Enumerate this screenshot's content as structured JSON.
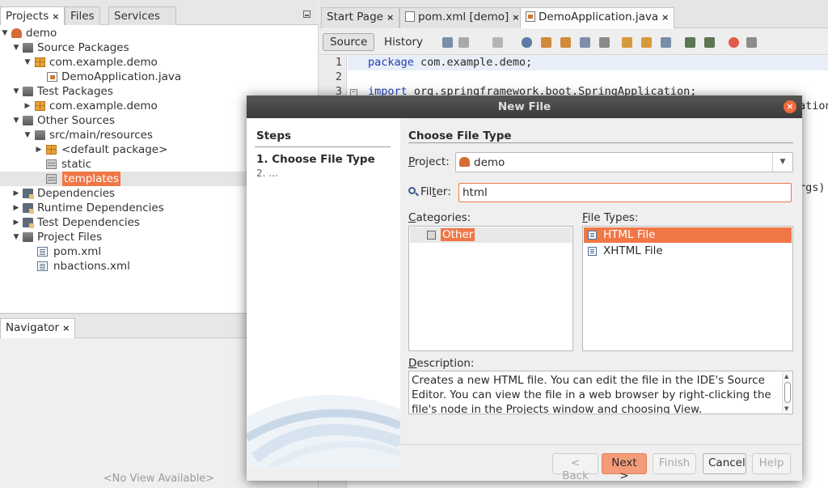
{
  "projects_panel": {
    "tabs": [
      {
        "label": "Projects",
        "active": true,
        "closable": true
      },
      {
        "label": "Files",
        "active": false,
        "closable": false
      },
      {
        "label": "Services",
        "active": false,
        "closable": false
      }
    ],
    "tree": [
      {
        "label": "demo",
        "icon": "project-icon",
        "toggle": "expanded"
      },
      {
        "label": "Source Packages",
        "icon": "source-packages-icon",
        "toggle": "expanded"
      },
      {
        "label": "com.example.demo",
        "icon": "package-icon",
        "toggle": "expanded"
      },
      {
        "label": "DemoApplication.java",
        "icon": "java-file-icon",
        "toggle": "none"
      },
      {
        "label": "Test Packages",
        "icon": "test-packages-icon",
        "toggle": "expanded"
      },
      {
        "label": "com.example.demo",
        "icon": "package-icon",
        "toggle": "collapsed"
      },
      {
        "label": "Other Sources",
        "icon": "other-sources-icon",
        "toggle": "expanded"
      },
      {
        "label": "src/main/resources",
        "icon": "resources-icon",
        "toggle": "expanded"
      },
      {
        "label": "<default package>",
        "icon": "package-icon",
        "toggle": "collapsed"
      },
      {
        "label": "static",
        "icon": "folder-icon",
        "toggle": "none"
      },
      {
        "label": "templates",
        "icon": "folder-icon",
        "toggle": "none",
        "selected": true
      },
      {
        "label": "Dependencies",
        "icon": "dependencies-icon",
        "toggle": "collapsed"
      },
      {
        "label": "Runtime Dependencies",
        "icon": "dependencies-icon",
        "toggle": "collapsed"
      },
      {
        "label": "Test Dependencies",
        "icon": "dependencies-icon",
        "toggle": "collapsed"
      },
      {
        "label": "Project Files",
        "icon": "project-files-icon",
        "toggle": "expanded"
      },
      {
        "label": "pom.xml",
        "icon": "xml-file-icon",
        "toggle": "none"
      },
      {
        "label": "nbactions.xml",
        "icon": "xml-file-icon",
        "toggle": "none"
      }
    ]
  },
  "navigator": {
    "tab_label": "Navigator",
    "empty_text": "<No View Available>"
  },
  "editor": {
    "tabs": [
      {
        "label": "Start Page",
        "icon": "",
        "active": false
      },
      {
        "label": "pom.xml [demo]",
        "icon": "xml-file-icon",
        "active": false
      },
      {
        "label": "DemoApplication.java",
        "icon": "java-file-icon",
        "active": true
      }
    ],
    "toolbar": {
      "source_label": "Source",
      "history_label": "History"
    },
    "lines": [
      {
        "num": "1",
        "keyword": "package",
        "rest": " com.example.demo;"
      },
      {
        "num": "2",
        "keyword": "",
        "rest": ""
      },
      {
        "num": "3",
        "keyword": "import",
        "rest": " org.springframework.boot.SpringApplication;"
      }
    ],
    "peek_right_1": "ation",
    "peek_right_2": "rgs)"
  },
  "dialog": {
    "title": "New File",
    "steps_heading": "Steps",
    "steps": [
      "1.  Choose File Type",
      "2.  ..."
    ],
    "section_heading": "Choose File Type",
    "project_label_underlined": "P",
    "project_label_rest": "roject:",
    "project_value": "demo",
    "filter_label_pre": "Fil",
    "filter_label_underlined": "t",
    "filter_label_post": "er:",
    "filter_value": "html",
    "categories_label_underlined": "C",
    "categories_label_rest": "ategories:",
    "categories": [
      {
        "label": "Other",
        "selected": true
      }
    ],
    "file_types_label_underlined": "F",
    "file_types_label_rest": "ile Types:",
    "file_types": [
      {
        "label": "HTML File",
        "selected": true
      },
      {
        "label": "XHTML File",
        "selected": false
      }
    ],
    "description_label_underlined": "D",
    "description_label_rest": "escription:",
    "description_text": "Creates a new HTML file. You can edit the file in the IDE's Source Editor. You can view the file in a web browser by right-clicking the file's node in the Projects window and choosing View.",
    "buttons": {
      "back": "< Back",
      "next": "Next >",
      "finish": "Finish",
      "cancel": "Cancel",
      "help": "Help"
    },
    "accent_color": "#f07746"
  }
}
